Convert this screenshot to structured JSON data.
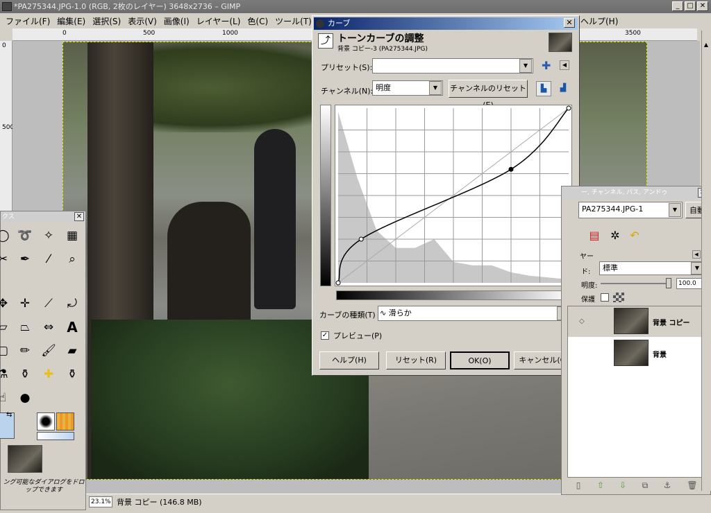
{
  "window": {
    "title": "*PA275344.JPG-1.0 (RGB, 2枚のレイヤー) 3648x2736 – GIMP",
    "minimize": "_",
    "maximize": "□",
    "close": "✕"
  },
  "menu": [
    "ファイル(F)",
    "編集(E)",
    "選択(S)",
    "表示(V)",
    "画像(I)",
    "レイヤー(L)",
    "色(C)",
    "ツール(T)"
  ],
  "ruler": {
    "h": [
      "0",
      "500",
      "1000",
      "3500"
    ],
    "v": [
      "0",
      "500"
    ]
  },
  "status": {
    "zoom": "23.1%",
    "text": "背景 コピー (146.8 MB)"
  },
  "toolbox": {
    "title": "ツールボックス",
    "title_visible": "クス",
    "close": "✕",
    "drop_hint": "ドラッグ可能なダイアログをドロップできます",
    "drop_hint_visible": "ング可能なダイアログをドロップできます"
  },
  "curves": {
    "title": "カーブ",
    "close": "✕",
    "heading": "トーンカーブの調整",
    "subheading": "背景 コピー-3 (PA275344.JPG)",
    "preset_label": "プリセット(S):",
    "preset_value": "",
    "channel_label": "チャンネル(N):",
    "channel_value": "明度",
    "reset_channel": "チャンネルのリセット(E)",
    "curve_type_label": "カーブの種類(T)",
    "curve_type_value": "滑らか",
    "preview_label": "プレビュー(P)",
    "preview_checked": "✓",
    "buttons": {
      "help": "ヘルプ(H)",
      "reset": "リセット(R)",
      "ok": "OK(O)",
      "cancel": "キャンセル(C)"
    },
    "curve_points": [
      [
        0,
        0
      ],
      [
        0.1,
        0.25
      ],
      [
        0.75,
        0.65
      ],
      [
        1,
        1
      ]
    ],
    "histogram_peaks": [
      0.98,
      0.6,
      0.3,
      0.2,
      0.2,
      0.25,
      0.12,
      0.1,
      0.1,
      0.06,
      0.04,
      0.03,
      0.02
    ]
  },
  "help_menu": "ヘルプ(H)",
  "layers": {
    "header": "レイヤー, チャンネル, パス, アンドゥ",
    "header_visible": "ー, チャンネル, パス, アンドゥ",
    "close": "✕",
    "image_select": "PA275344.JPG-1",
    "auto": "自動",
    "section_label": "ヤー",
    "mode_label": "ド:",
    "mode_value": "標準",
    "opacity_label": "明度:",
    "opacity_value": "100.0",
    "lock_label": "保護",
    "items": [
      {
        "name": "背景 コピー"
      },
      {
        "name": "背景"
      }
    ]
  },
  "ruler_right": "3500"
}
